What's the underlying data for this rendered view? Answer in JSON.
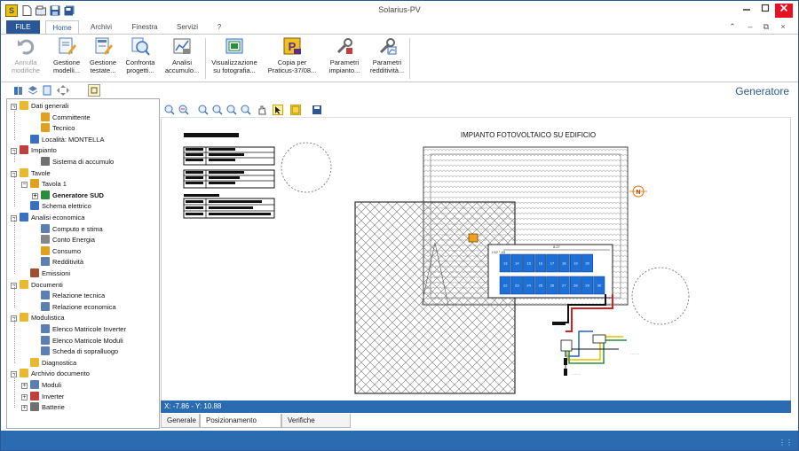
{
  "window": {
    "title": "Solarius-PV"
  },
  "ribbon_tabs": [
    {
      "label": "FILE"
    },
    {
      "label": "Home"
    },
    {
      "label": "Archivi"
    },
    {
      "label": "Finestra"
    },
    {
      "label": "Servizi"
    },
    {
      "label": "?"
    }
  ],
  "ribbon_buttons": [
    {
      "line1": "Annulla",
      "line2": "modifiche",
      "icon": "undo-icon"
    },
    {
      "line1": "Gestione",
      "line2": "modelli...",
      "icon": "edit-models-icon"
    },
    {
      "line1": "Gestione",
      "line2": "testate...",
      "icon": "edit-headers-icon"
    },
    {
      "line1": "Confronta",
      "line2": "progetti...",
      "icon": "compare-icon"
    },
    {
      "line1": "Analisi",
      "line2": "accumulo...",
      "icon": "chart-icon"
    },
    {
      "line1": "Visualizzazione",
      "line2": "su fotografia...",
      "icon": "photo-icon"
    },
    {
      "line1": "Copia per",
      "line2": "Praticus-37/08...",
      "icon": "praticus-icon"
    },
    {
      "line1": "Parametri",
      "line2": "impianto...",
      "icon": "tools-icon"
    },
    {
      "line1": "Parametri",
      "line2": "redditività...",
      "icon": "tools-chart-icon"
    }
  ],
  "tree": [
    {
      "label": "Dati generali",
      "level": 0,
      "expander": "−",
      "icon": "folder-icon",
      "color": "#e8b830"
    },
    {
      "label": "Committente",
      "level": 2,
      "icon": "person-icon",
      "color": "#e0a020"
    },
    {
      "label": "Tecnico",
      "level": 2,
      "icon": "person-icon",
      "color": "#e0a020"
    },
    {
      "label": "Località: MONTELLA",
      "level": 1,
      "icon": "globe-icon",
      "color": "#3a70c0"
    },
    {
      "label": "Impianto",
      "level": 0,
      "expander": "−",
      "icon": "plant-icon",
      "color": "#c04040"
    },
    {
      "label": "Sistema di accumulo",
      "level": 2,
      "icon": "battery-icon",
      "color": "#707070"
    },
    {
      "label": "Tavole",
      "level": 0,
      "expander": "−",
      "icon": "boards-icon",
      "color": "#e8b830"
    },
    {
      "label": "Tavola 1",
      "level": 1,
      "expander": "−",
      "icon": "board-icon",
      "color": "#e0a020"
    },
    {
      "label": "Generatore SUD",
      "level": 2,
      "expander": "+",
      "icon": "generator-icon",
      "color": "#2e8b3a",
      "bold": true
    },
    {
      "label": "Schema elettrico",
      "level": 1,
      "icon": "schema-icon",
      "color": "#3a70c0"
    },
    {
      "label": "Analisi economica",
      "level": 0,
      "expander": "−",
      "icon": "euro-icon",
      "color": "#3a70c0"
    },
    {
      "label": "Computo e stima",
      "level": 2,
      "icon": "doc-icon",
      "color": "#5a7fb0"
    },
    {
      "label": "Conto Energia",
      "level": 2,
      "icon": "energy-icon",
      "color": "#888888"
    },
    {
      "label": "Consumo",
      "level": 2,
      "icon": "consumption-icon",
      "color": "#e0a020"
    },
    {
      "label": "Redditività",
      "level": 2,
      "icon": "chart-icon",
      "color": "#5a7fb0"
    },
    {
      "label": "Emissioni",
      "level": 1,
      "icon": "factory-icon",
      "color": "#a05030"
    },
    {
      "label": "Documenti",
      "level": 0,
      "expander": "−",
      "icon": "folder-icon",
      "color": "#e8b830"
    },
    {
      "label": "Relazione tecnica",
      "level": 2,
      "icon": "doc-icon",
      "color": "#5a7fb0"
    },
    {
      "label": "Relazione economica",
      "level": 2,
      "icon": "doc-icon",
      "color": "#5a7fb0"
    },
    {
      "label": "Modulistica",
      "level": 0,
      "expander": "−",
      "icon": "folder-icon",
      "color": "#e8b830"
    },
    {
      "label": "Elenco Matricole Inverter",
      "level": 2,
      "icon": "doc-icon",
      "color": "#5a7fb0"
    },
    {
      "label": "Elenco Matricole Moduli",
      "level": 2,
      "icon": "doc-icon",
      "color": "#5a7fb0"
    },
    {
      "label": "Scheda di sopralluogo",
      "level": 2,
      "icon": "doc-icon",
      "color": "#5a7fb0"
    },
    {
      "label": "Diagnostica",
      "level": 1,
      "icon": "diagnostics-icon",
      "color": "#e8b830"
    },
    {
      "label": "Archivio documento",
      "level": 0,
      "expander": "−",
      "icon": "archive-icon",
      "color": "#e8b830"
    },
    {
      "label": "Moduli",
      "level": 1,
      "expander": "+",
      "icon": "modules-icon",
      "color": "#5a7fb0"
    },
    {
      "label": "Inverter",
      "level": 1,
      "expander": "+",
      "icon": "inverter-icon",
      "color": "#c04040"
    },
    {
      "label": "Batterie",
      "level": 1,
      "expander": "+",
      "icon": "battery-icon",
      "color": "#707070"
    }
  ],
  "panel": {
    "title": "Generatore"
  },
  "drawing": {
    "title": "IMPIANTO FOTOVOLTAICO SU EDIFICIO",
    "north_label": "N",
    "module_rows": [
      [
        "13",
        "14",
        "15",
        "16",
        "17",
        "18",
        "19",
        "20"
      ],
      [
        "22",
        "23",
        "24",
        "25",
        "26",
        "27",
        "28",
        "29",
        "30"
      ]
    ],
    "row_label": "I 02 ° 43",
    "dim_label": "8.27"
  },
  "coordinates": "X: -7.86 - Y: 10.88",
  "bottom_tabs": [
    {
      "label": "Generale"
    },
    {
      "label": "Posizionamento moduli"
    },
    {
      "label": "Verifiche elettriche"
    }
  ],
  "colors": {
    "accent": "#2b5797",
    "status": "#2b6cb0",
    "close": "#e81123",
    "module": "#1e6fd6"
  }
}
